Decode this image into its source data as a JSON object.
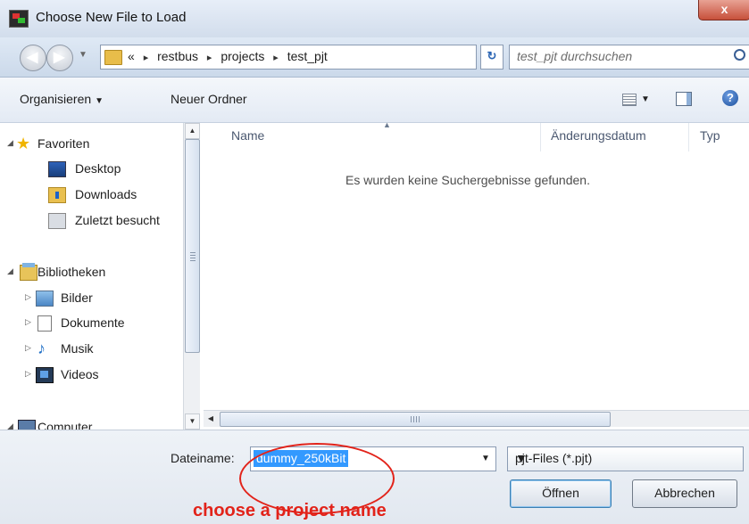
{
  "window": {
    "title": "Choose New File to Load",
    "close_label": "x"
  },
  "address_bar": {
    "overflow": "«",
    "breadcrumbs": [
      "restbus",
      "projects",
      "test_pjt"
    ],
    "separator": "▸",
    "search_placeholder": "test_pjt durchsuchen"
  },
  "toolbar": {
    "organize_label": "Organisieren",
    "new_folder_label": "Neuer Ordner",
    "help_label": "?"
  },
  "nav_pane": {
    "items": [
      {
        "label": "Favoriten",
        "icon": "star-icon"
      },
      {
        "label": "Desktop",
        "icon": "desktop-icon"
      },
      {
        "label": "Downloads",
        "icon": "downloads-folder-icon"
      },
      {
        "label": "Zuletzt besucht",
        "icon": "recent-places-icon"
      },
      {
        "label": "Bibliotheken",
        "icon": "libraries-icon"
      },
      {
        "label": "Bilder",
        "icon": "pictures-icon"
      },
      {
        "label": "Dokumente",
        "icon": "documents-icon"
      },
      {
        "label": "Musik",
        "icon": "music-icon"
      },
      {
        "label": "Videos",
        "icon": "videos-icon"
      },
      {
        "label": "Computer",
        "icon": "computer-icon"
      }
    ]
  },
  "file_list": {
    "columns": [
      "Name",
      "Änderungsdatum",
      "Typ"
    ],
    "empty_message": "Es wurden keine Suchergebnisse gefunden.",
    "scroll_grip": "III"
  },
  "footer": {
    "filename_label": "Dateiname:",
    "filename_value": "dummy_250kBit",
    "filetype_value": "pjt-Files (*.pjt)",
    "open_label": "Öffnen",
    "cancel_label": "Abbrechen"
  },
  "annotation": {
    "text": "choose a project name",
    "color": "#e2231a"
  }
}
